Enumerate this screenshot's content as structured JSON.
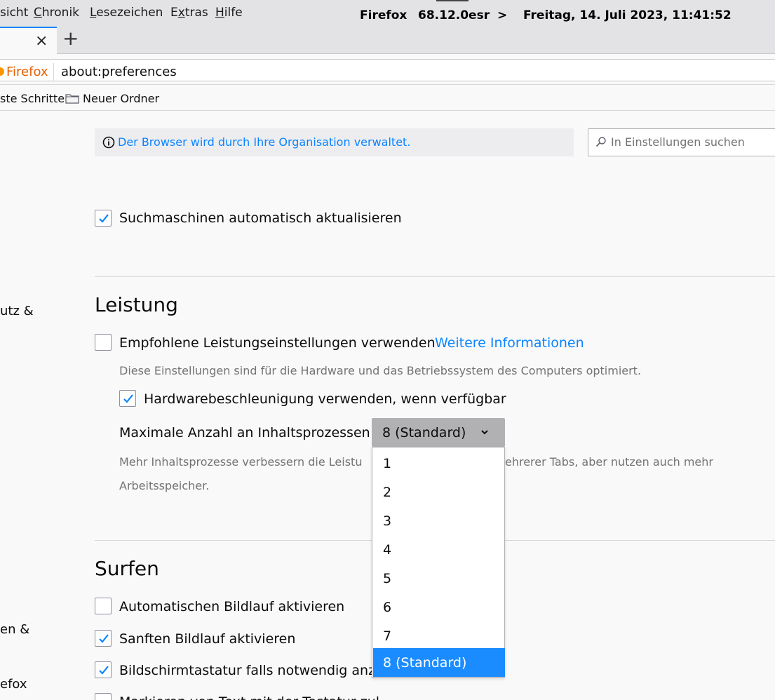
{
  "menubar": {
    "items": [
      {
        "text": "sicht",
        "accel": ""
      },
      {
        "text": "Chronik",
        "accel": "C"
      },
      {
        "text": "Lesezeichen",
        "accel": "L"
      },
      {
        "text": "Extras",
        "accel": "x"
      },
      {
        "text": "Hilfe",
        "accel": "H"
      }
    ],
    "info_app": "Firefox",
    "info_version": "68.12.0esr",
    "info_sep": ">",
    "info_datetime": "Freitag, 14. Juli 2023, 11:41:52"
  },
  "tabs": {
    "close_glyph": "×",
    "new_tab_glyph": "+"
  },
  "urlbar": {
    "identity_label": "Firefox",
    "url": "about:preferences"
  },
  "bookmarks": {
    "items": [
      "ste Schritte",
      "Neuer Ordner"
    ]
  },
  "sidebar": {
    "fragments": [
      "utz &",
      "en &",
      "efox"
    ]
  },
  "banner": {
    "text": "Der Browser wird durch Ihre Organisation verwaltet."
  },
  "search": {
    "placeholder": "In Einstellungen suchen"
  },
  "search_engines": {
    "auto_update": {
      "label": "Suchmaschinen automatisch aktualisieren",
      "checked": true
    }
  },
  "performance": {
    "heading": "Leistung",
    "recommended": {
      "label": "Empfohlene Leistungseinstellungen verwenden",
      "checked": false
    },
    "more_info_link": "Weitere Informationen",
    "recommended_desc": "Diese Einstellungen sind für die Hardware und das Betriebssystem des Computers optimiert.",
    "hw_accel": {
      "label": "Hardwarebeschleunigung verwenden, wenn verfügbar",
      "checked": true
    },
    "content_processes": {
      "label": "Maximale Anzahl an Inhaltsprozessen",
      "selected": "8 (Standard)",
      "options": [
        "1",
        "2",
        "3",
        "4",
        "5",
        "6",
        "7",
        "8 (Standard)"
      ]
    },
    "content_processes_desc_line1_left": "Mehr Inhaltsprozesse verbessern die Leistu",
    "content_processes_desc_line1_right": "ehrerer Tabs, aber nutzen auch mehr",
    "content_processes_desc_line2": "Arbeitsspeicher."
  },
  "browsing": {
    "heading": "Surfen",
    "autoscroll": {
      "label": "Automatischen Bildlauf aktivieren",
      "checked": false
    },
    "smooth_scroll": {
      "label": "Sanften Bildlauf aktivieren",
      "checked": true
    },
    "touch_keyboard": {
      "label": "Bildschirmtastatur falls notwendig anzeig",
      "checked": true
    },
    "caret_browsing": {
      "label": "Markieren von Text mit der Tastatur zul",
      "checked": false
    }
  },
  "colors": {
    "accent": "#0a84ff",
    "selected_option": "#1a8cff",
    "identity": "#e66000"
  }
}
